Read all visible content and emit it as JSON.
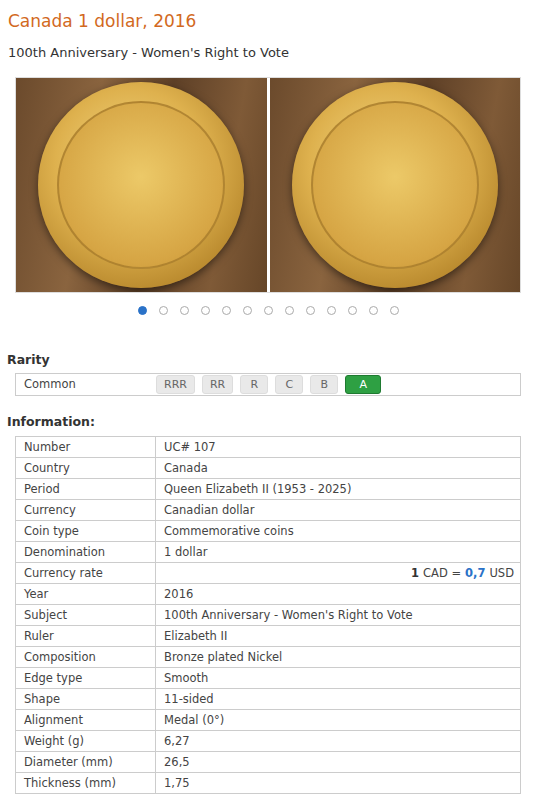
{
  "title": "Canada 1 dollar, 2016",
  "subtitle": "100th Anniversary - Women's Right to Vote",
  "gallery": {
    "dots": [
      {
        "selected": true
      },
      {
        "selected": false
      },
      {
        "selected": false
      },
      {
        "selected": false
      },
      {
        "selected": false
      },
      {
        "selected": false
      },
      {
        "selected": false
      },
      {
        "selected": false
      },
      {
        "selected": false
      },
      {
        "selected": false
      },
      {
        "selected": false
      },
      {
        "selected": false
      },
      {
        "selected": false
      }
    ]
  },
  "rarity": {
    "heading": "Rarity",
    "label": "Common",
    "levels": [
      {
        "label": "RRR",
        "selected": false
      },
      {
        "label": "RR",
        "selected": false
      },
      {
        "label": "R",
        "selected": false
      },
      {
        "label": "C",
        "selected": false
      },
      {
        "label": "B",
        "selected": false
      },
      {
        "label": "A",
        "selected": true
      }
    ]
  },
  "information": {
    "heading": "Information:",
    "rows": [
      {
        "kind": "text",
        "label": "Number",
        "value": "UC# 107"
      },
      {
        "kind": "text",
        "label": "Country",
        "value": "Canada"
      },
      {
        "kind": "text",
        "label": "Period",
        "value": "Queen Elizabeth II (1953 - 2025)"
      },
      {
        "kind": "text",
        "label": "Currency",
        "value": "Canadian dollar"
      },
      {
        "kind": "text",
        "label": "Coin type",
        "value": "Commemorative coins"
      },
      {
        "kind": "text",
        "label": "Denomination",
        "value": "1 dollar"
      },
      {
        "kind": "rate",
        "label": "Currency rate",
        "base_amount": "1",
        "base_currency": "CAD =",
        "rate": "0,7",
        "quote": "USD"
      },
      {
        "kind": "text",
        "label": "Year",
        "value": "2016"
      },
      {
        "kind": "text",
        "label": "Subject",
        "value": "100th Anniversary - Women's Right to Vote"
      },
      {
        "kind": "text",
        "label": "Ruler",
        "value": "Elizabeth II"
      },
      {
        "kind": "text",
        "label": "Composition",
        "value": "Bronze plated Nickel"
      },
      {
        "kind": "text",
        "label": "Edge type",
        "value": "Smooth"
      },
      {
        "kind": "text",
        "label": "Shape",
        "value": "11-sided"
      },
      {
        "kind": "text",
        "label": "Alignment",
        "value": "Medal (0°)"
      },
      {
        "kind": "text",
        "label": "Weight (g)",
        "value": "6,27"
      },
      {
        "kind": "text",
        "label": "Diameter (mm)",
        "value": "26,5"
      },
      {
        "kind": "text",
        "label": "Thickness (mm)",
        "value": "1,75"
      }
    ]
  }
}
